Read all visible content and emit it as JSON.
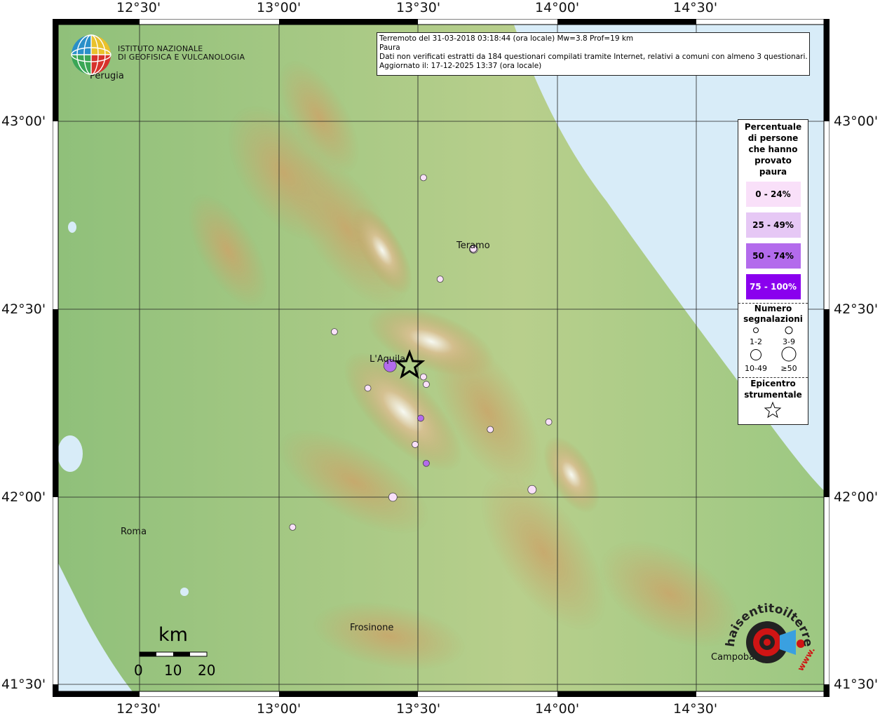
{
  "header": {
    "line1": "Terremoto del 31-03-2018 03:18:44 (ora locale) Mw=3.8 Prof=19 km",
    "line2": "Paura",
    "line3": "Dati non verificati estratti da 184 questionari compilati tramite Internet, relativi a comuni con almeno 3 questionari.",
    "line4": "Aggiornato il: 17-12-2025 13:37 (ora locale)"
  },
  "institute": {
    "line1": "ISTITUTO NAZIONALE",
    "line2": "DI GEOFISICA E VULCANOLOGIA"
  },
  "axes": {
    "lon_ticks": [
      "12°30'",
      "13°00'",
      "13°30'",
      "14°00'",
      "14°30'"
    ],
    "lat_ticks": [
      "43°00'",
      "42°30'",
      "42°00'",
      "41°30'"
    ]
  },
  "cities": {
    "perugia": "Perugia",
    "teramo": "Teramo",
    "laquila": "L'Aquila",
    "roma": "Roma",
    "frosinone": "Frosinone",
    "campobasso": "Campobasso"
  },
  "legend": {
    "title_lines": [
      "Percentuale",
      "di persone",
      "che hanno",
      "provato",
      "paura"
    ],
    "classes": [
      {
        "label": "0 - 24%",
        "color": "#f9e0f9"
      },
      {
        "label": "25 - 49%",
        "color": "#e6c8f5"
      },
      {
        "label": "50 - 74%",
        "color": "#b36bec"
      },
      {
        "label": "75 - 100%",
        "color": "#8a00ee"
      }
    ],
    "count_title_lines": [
      "Numero",
      "segnalazioni"
    ],
    "count_classes": [
      "1-2",
      "3-9",
      "10-49",
      "≥50"
    ],
    "epicenter_title_lines": [
      "Epicentro",
      "strumentale"
    ]
  },
  "scalebar": {
    "unit": "km",
    "labels": [
      "0",
      "10",
      "20"
    ]
  },
  "watermark": {
    "text": "haisentitoilterremoto.it",
    "url": "www."
  },
  "colors": {
    "sea": "#d8ecf8",
    "lowland": "#a8c98a",
    "mountain": "#c9a66b"
  },
  "points": [
    {
      "lat": 42.85,
      "lon": 13.52,
      "class": 0,
      "size": "1-2"
    },
    {
      "lat": 42.66,
      "lon": 13.7,
      "class": 0,
      "size": "3-9"
    },
    {
      "lat": 42.58,
      "lon": 13.58,
      "class": 0,
      "size": "1-2"
    },
    {
      "lat": 42.44,
      "lon": 13.2,
      "class": 0,
      "size": "1-2"
    },
    {
      "lat": 42.35,
      "lon": 13.4,
      "class": 2,
      "size": "10-49"
    },
    {
      "lat": 42.32,
      "lon": 13.52,
      "class": 0,
      "size": "1-2"
    },
    {
      "lat": 42.3,
      "lon": 13.53,
      "class": 0,
      "size": "1-2"
    },
    {
      "lat": 42.29,
      "lon": 13.32,
      "class": 0,
      "size": "1-2"
    },
    {
      "lat": 42.21,
      "lon": 13.51,
      "class": 2,
      "size": "1-2"
    },
    {
      "lat": 42.2,
      "lon": 13.97,
      "class": 0,
      "size": "1-2"
    },
    {
      "lat": 42.18,
      "lon": 13.76,
      "class": 0,
      "size": "1-2"
    },
    {
      "lat": 42.14,
      "lon": 13.49,
      "class": 0,
      "size": "1-2"
    },
    {
      "lat": 42.09,
      "lon": 13.53,
      "class": 2,
      "size": "1-2"
    },
    {
      "lat": 42.02,
      "lon": 13.91,
      "class": 0,
      "size": "3-9"
    },
    {
      "lat": 42.0,
      "lon": 13.41,
      "class": 0,
      "size": "3-9"
    },
    {
      "lat": 41.92,
      "lon": 13.05,
      "class": 0,
      "size": "1-2"
    }
  ],
  "epicenter": {
    "lat": 42.35,
    "lon": 13.47
  }
}
